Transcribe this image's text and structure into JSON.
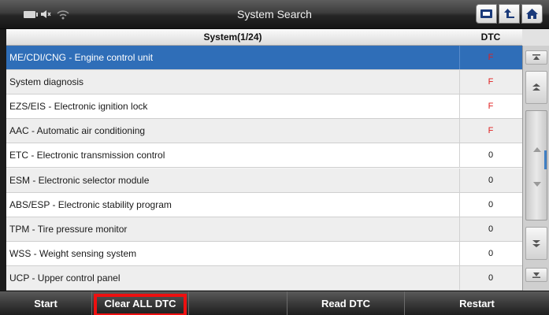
{
  "titlebar": {
    "title": "System Search",
    "status_icons": [
      "battery-icon",
      "speaker-icon",
      "wifi-icon"
    ],
    "buttons": [
      "screen-capture-icon",
      "back-icon",
      "home-icon"
    ]
  },
  "columns": {
    "system": "System(1/24)",
    "dtc": "DTC"
  },
  "rows": [
    {
      "name": "ME/CDI/CNG - Engine control unit",
      "dtc": "F",
      "selected": true
    },
    {
      "name": "System diagnosis",
      "dtc": "F",
      "selected": false
    },
    {
      "name": "EZS/EIS - Electronic ignition lock",
      "dtc": "F",
      "selected": false
    },
    {
      "name": "AAC - Automatic air conditioning",
      "dtc": "F",
      "selected": false
    },
    {
      "name": "ETC - Electronic transmission control",
      "dtc": "0",
      "selected": false
    },
    {
      "name": "ESM - Electronic selector module",
      "dtc": "0",
      "selected": false
    },
    {
      "name": "ABS/ESP - Electronic stability program",
      "dtc": "0",
      "selected": false
    },
    {
      "name": "TPM - Tire pressure monitor",
      "dtc": "0",
      "selected": false
    },
    {
      "name": "WSS - Weight sensing system",
      "dtc": "0",
      "selected": false
    },
    {
      "name": "UCP - Upper control panel",
      "dtc": "0",
      "selected": false
    }
  ],
  "footer": {
    "buttons": [
      {
        "label": "Start",
        "highlighted": false
      },
      {
        "label": "Clear ALL DTC",
        "highlighted": true
      },
      {
        "label": "",
        "highlighted": false
      },
      {
        "label": "Read DTC",
        "highlighted": false
      },
      {
        "label": "Restart",
        "highlighted": false
      }
    ]
  },
  "colors": {
    "selected_row": "#2f6eb8",
    "fault_text": "#e02020",
    "highlight_box": "#ee1010"
  }
}
